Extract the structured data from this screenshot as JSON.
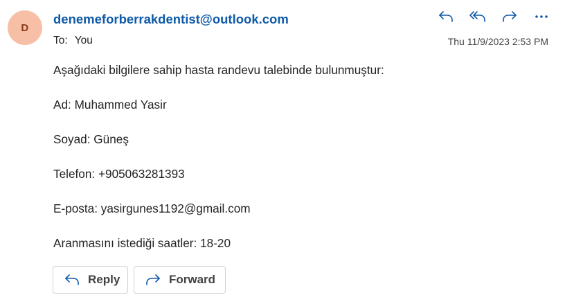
{
  "header": {
    "avatar_initial": "D",
    "sender": "denemeforberrakdentist@outlook.com",
    "to_label": "To:",
    "to_value": "You",
    "timestamp": "Thu 11/9/2023 2:53 PM",
    "actions": [
      {
        "name": "reply",
        "icon": "reply-icon"
      },
      {
        "name": "reply-all",
        "icon": "reply-all-icon"
      },
      {
        "name": "forward",
        "icon": "forward-icon"
      },
      {
        "name": "more",
        "icon": "more-icon"
      }
    ]
  },
  "body": {
    "lines": [
      "Aşağıdaki bilgilere sahip hasta randevu talebinde bulunmuştur:",
      "Ad: Muhammed Yasir",
      "Soyad: Güneş",
      "Telefon: +905063281393",
      "E-posta: yasirgunes1192@gmail.com",
      "Aranmasını istediği saatler: 18-20"
    ]
  },
  "footer": {
    "reply_label": "Reply",
    "forward_label": "Forward"
  },
  "colors": {
    "accent": "#0f5aa8",
    "avatar_bg": "#f7bfa6",
    "avatar_text": "#8a3a1c",
    "border": "#d1d1d1"
  }
}
